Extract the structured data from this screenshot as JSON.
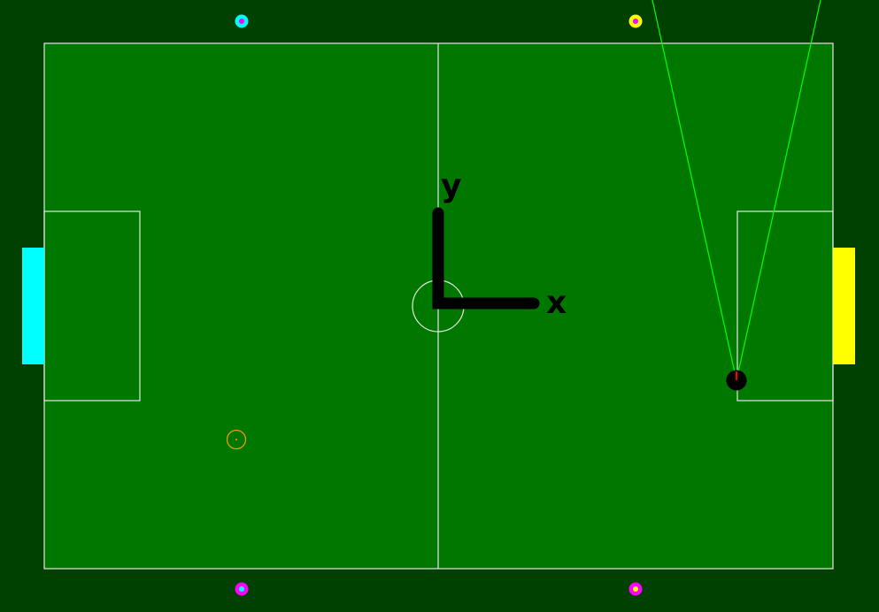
{
  "field": {
    "colors": {
      "border": "#004000",
      "pitch": "#007800",
      "lines": "#e6e6e6",
      "left_goal": "#00ffff",
      "right_goal": "#ffff00",
      "robot": "#000000",
      "robot_heading": "#ff0000",
      "vision_rays": "#00ff00",
      "ball_marker": "#ff9900"
    }
  },
  "axes": {
    "x_label": "x",
    "y_label": "y"
  },
  "beacons": [
    {
      "id": "top-left",
      "inner": "#ff00ff",
      "outer": "#00ffff"
    },
    {
      "id": "top-right",
      "inner": "#ff00ff",
      "outer": "#ffff00"
    },
    {
      "id": "bottom-left",
      "inner": "#00ffff",
      "outer": "#ff00ff"
    },
    {
      "id": "bottom-right",
      "inner": "#ffff00",
      "outer": "#ff00ff"
    }
  ],
  "robot": {
    "icon": "robot-icon"
  },
  "ball": {
    "icon": "ball-target-icon"
  }
}
